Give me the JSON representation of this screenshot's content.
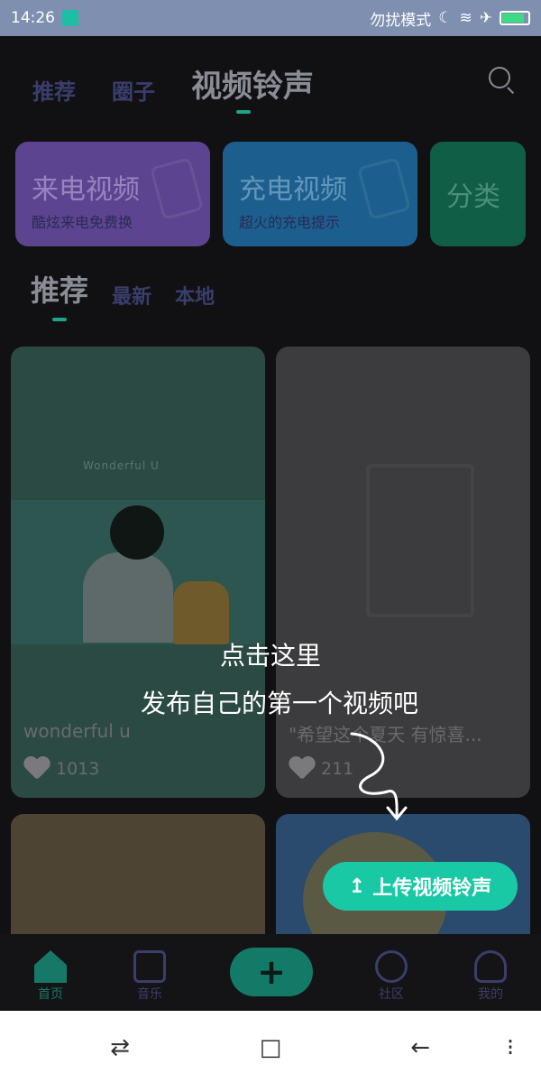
{
  "status_bar": {
    "time": "14:26",
    "mode_text": "勿扰模式",
    "icons": [
      "usb-icon",
      "moon-icon",
      "wifi-icon",
      "airplane-icon",
      "battery-icon"
    ]
  },
  "top_tabs": [
    {
      "label": "推荐",
      "active": false
    },
    {
      "label": "圈子",
      "active": false
    },
    {
      "label": "视频铃声",
      "active": true
    }
  ],
  "categories": [
    {
      "title": "来电视频",
      "subtitle": "酷炫来电免费换"
    },
    {
      "title": "充电视频",
      "subtitle": "超火的充电提示"
    },
    {
      "title": "分类",
      "subtitle": ""
    }
  ],
  "sub_tabs": [
    {
      "label": "推荐",
      "active": true
    },
    {
      "label": "最新",
      "active": false
    },
    {
      "label": "本地",
      "active": false
    }
  ],
  "cards": [
    {
      "title": "wonderful u",
      "likes": "1013",
      "art_text": "Wonderful U"
    },
    {
      "title": "\"希望这个夏天 有惊喜...",
      "likes": "211"
    }
  ],
  "guide": {
    "line1": "点击这里",
    "line2": "发布自己的第一个视频吧"
  },
  "upload_button": {
    "icon": "↥",
    "label": "上传视频铃声"
  },
  "bottom_nav": [
    {
      "label": "首页",
      "icon": "home-icon",
      "active": true
    },
    {
      "label": "音乐",
      "icon": "music-icon",
      "active": false
    },
    {
      "label": "社区",
      "icon": "planet-icon",
      "active": false
    },
    {
      "label": "我的",
      "icon": "user-icon",
      "active": false
    }
  ],
  "plus_button": {
    "label": "+"
  },
  "system_nav": {
    "menu": "⇄",
    "home": "□",
    "back": "←",
    "more": "⁝"
  },
  "colors": {
    "accent": "#19c9a6",
    "background": "#111114",
    "status_bar": "#7e8fb0"
  }
}
